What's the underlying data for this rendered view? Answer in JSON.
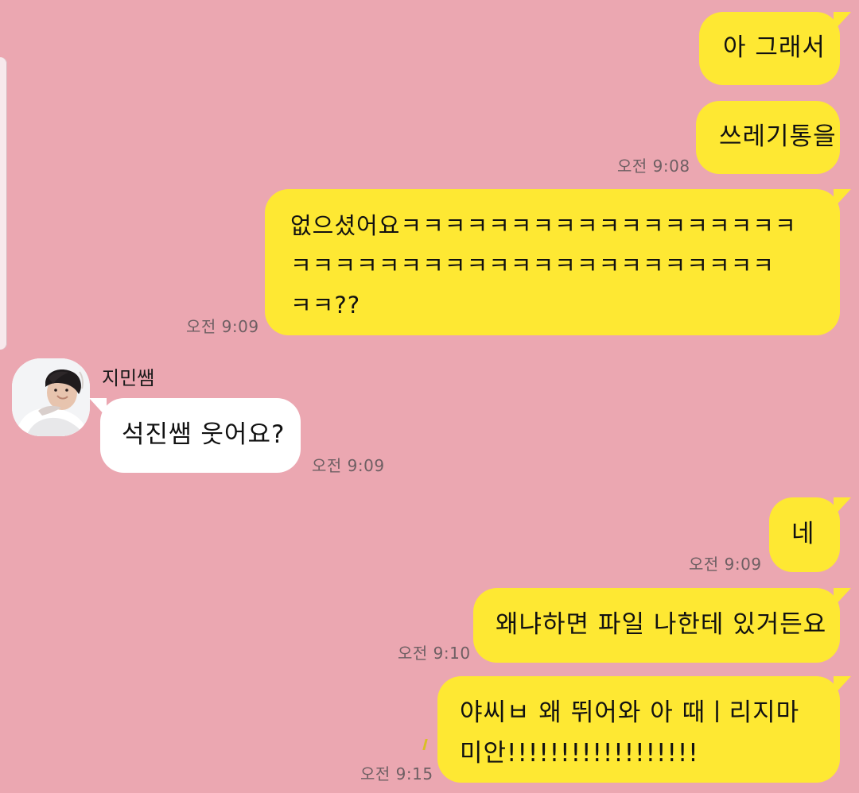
{
  "chat": {
    "partner_name": "지민쌤",
    "messages": [
      {
        "id": "m1",
        "from": "me",
        "text": "아 그래서"
      },
      {
        "id": "m2",
        "from": "me",
        "text": "쓰레기통을",
        "time": "오전 9:08"
      },
      {
        "id": "m3",
        "from": "me",
        "lines": [
          "없으셨어요ㅋㅋㅋㅋㅋㅋㅋㅋㅋㅋㅋㅋㅋㅋㅋㅋㅋㅋ",
          "ㅋㅋㅋㅋㅋㅋㅋㅋㅋㅋㅋㅋㅋㅋㅋㅋㅋㅋㅋㅋㅋㅋ",
          "ㅋㅋ??"
        ],
        "time": "오전 9:09"
      },
      {
        "id": "m4",
        "from": "partner",
        "text": "석진쌤 웃어요?",
        "time": "오전 9:09"
      },
      {
        "id": "m5",
        "from": "me",
        "text": "네",
        "time": "오전 9:09"
      },
      {
        "id": "m6",
        "from": "me",
        "text": "왜냐하면 파일 나한테 있거든요",
        "time": "오전 9:10"
      },
      {
        "id": "m7",
        "from": "me",
        "lines": [
          "야씨ㅂ 왜 뛰어와 아 때ㅣ리지마",
          "미안!!!!!!!!!!!!!!!!!!"
        ],
        "time": "오전 9:15"
      }
    ]
  },
  "colors": {
    "background": "#eba7b1",
    "my_bubble": "#fee833",
    "partner_bubble": "#ffffff",
    "timestamp": "#6e5f63"
  },
  "icons": {
    "avatar": "profile-photo-avatar"
  }
}
